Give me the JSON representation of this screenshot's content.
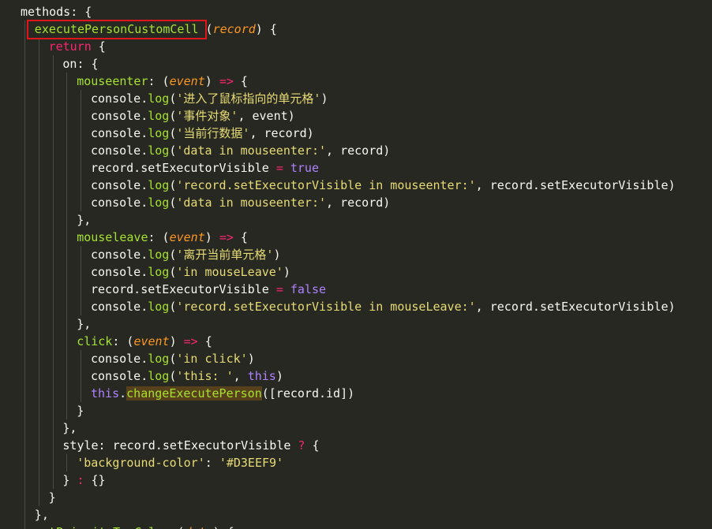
{
  "editor": {
    "lines": [
      {
        "indent": 0,
        "tokens": [
          [
            "t",
            "methods: {"
          ]
        ]
      },
      {
        "indent": 1,
        "tokens": [
          [
            "f",
            "executePersonCustomCell"
          ],
          [
            "t",
            " ("
          ],
          [
            "p",
            "record"
          ],
          [
            "t",
            ") {"
          ]
        ]
      },
      {
        "indent": 2,
        "tokens": [
          [
            "k",
            "return"
          ],
          [
            "t",
            " {"
          ]
        ]
      },
      {
        "indent": 3,
        "tokens": [
          [
            "t",
            "on: {"
          ]
        ]
      },
      {
        "indent": 4,
        "tokens": [
          [
            "f",
            "mouseenter"
          ],
          [
            "t",
            ": ("
          ],
          [
            "p",
            "event"
          ],
          [
            "t",
            ") "
          ],
          [
            "k",
            "=>"
          ],
          [
            "t",
            " {"
          ]
        ]
      },
      {
        "indent": 5,
        "tokens": [
          [
            "t",
            "console."
          ],
          [
            "f",
            "log"
          ],
          [
            "t",
            "("
          ],
          [
            "s",
            "'进入了鼠标指向的单元格'"
          ],
          [
            "t",
            ")"
          ]
        ]
      },
      {
        "indent": 5,
        "tokens": [
          [
            "t",
            "console."
          ],
          [
            "f",
            "log"
          ],
          [
            "t",
            "("
          ],
          [
            "s",
            "'事件对象'"
          ],
          [
            "t",
            ", event)"
          ]
        ]
      },
      {
        "indent": 5,
        "tokens": [
          [
            "t",
            "console."
          ],
          [
            "f",
            "log"
          ],
          [
            "t",
            "("
          ],
          [
            "s",
            "'当前行数据'"
          ],
          [
            "t",
            ", record)"
          ]
        ]
      },
      {
        "indent": 5,
        "tokens": [
          [
            "t",
            "console."
          ],
          [
            "f",
            "log"
          ],
          [
            "t",
            "("
          ],
          [
            "s",
            "'data in mouseenter:'"
          ],
          [
            "t",
            ", record)"
          ]
        ]
      },
      {
        "indent": 5,
        "tokens": [
          [
            "t",
            "record.setExecutorVisible "
          ],
          [
            "k",
            "="
          ],
          [
            "t",
            " "
          ],
          [
            "c",
            "true"
          ]
        ]
      },
      {
        "indent": 5,
        "tokens": [
          [
            "t",
            "console."
          ],
          [
            "f",
            "log"
          ],
          [
            "t",
            "("
          ],
          [
            "s",
            "'record.setExecutorVisible in mouseenter:'"
          ],
          [
            "t",
            ", record.setExecutorVisible)"
          ]
        ]
      },
      {
        "indent": 5,
        "tokens": [
          [
            "t",
            "console."
          ],
          [
            "f",
            "log"
          ],
          [
            "t",
            "("
          ],
          [
            "s",
            "'data in mouseenter:'"
          ],
          [
            "t",
            ", record)"
          ]
        ]
      },
      {
        "indent": 4,
        "tokens": [
          [
            "t",
            "},"
          ]
        ]
      },
      {
        "indent": 4,
        "tokens": [
          [
            "f",
            "mouseleave"
          ],
          [
            "t",
            ": ("
          ],
          [
            "p",
            "event"
          ],
          [
            "t",
            ") "
          ],
          [
            "k",
            "=>"
          ],
          [
            "t",
            " {"
          ]
        ]
      },
      {
        "indent": 5,
        "tokens": [
          [
            "t",
            "console."
          ],
          [
            "f",
            "log"
          ],
          [
            "t",
            "("
          ],
          [
            "s",
            "'离开当前单元格'"
          ],
          [
            "t",
            ")"
          ]
        ]
      },
      {
        "indent": 5,
        "tokens": [
          [
            "t",
            "console."
          ],
          [
            "f",
            "log"
          ],
          [
            "t",
            "("
          ],
          [
            "s",
            "'in mouseLeave'"
          ],
          [
            "t",
            ")"
          ]
        ]
      },
      {
        "indent": 5,
        "tokens": [
          [
            "t",
            "record.setExecutorVisible "
          ],
          [
            "k",
            "="
          ],
          [
            "t",
            " "
          ],
          [
            "c",
            "false"
          ]
        ]
      },
      {
        "indent": 5,
        "tokens": [
          [
            "t",
            "console."
          ],
          [
            "f",
            "log"
          ],
          [
            "t",
            "("
          ],
          [
            "s",
            "'record.setExecutorVisible in mouseLeave:'"
          ],
          [
            "t",
            ", record.setExecutorVisible)"
          ]
        ]
      },
      {
        "indent": 4,
        "tokens": [
          [
            "t",
            "},"
          ]
        ]
      },
      {
        "indent": 4,
        "tokens": [
          [
            "f",
            "click"
          ],
          [
            "t",
            ": ("
          ],
          [
            "p",
            "event"
          ],
          [
            "t",
            ") "
          ],
          [
            "k",
            "=>"
          ],
          [
            "t",
            " {"
          ]
        ]
      },
      {
        "indent": 5,
        "tokens": [
          [
            "t",
            "console."
          ],
          [
            "f",
            "log"
          ],
          [
            "t",
            "("
          ],
          [
            "s",
            "'in click'"
          ],
          [
            "t",
            ")"
          ]
        ]
      },
      {
        "indent": 5,
        "tokens": [
          [
            "t",
            "console."
          ],
          [
            "f",
            "log"
          ],
          [
            "t",
            "("
          ],
          [
            "s",
            "'this: '"
          ],
          [
            "t",
            ", "
          ],
          [
            "c",
            "this"
          ],
          [
            "t",
            ")"
          ]
        ]
      },
      {
        "indent": 5,
        "tokens": [
          [
            "c",
            "this"
          ],
          [
            "t",
            "."
          ],
          [
            "f",
            "changeExecutePerson"
          ],
          [
            "t",
            "([record.id])"
          ]
        ]
      },
      {
        "indent": 4,
        "tokens": [
          [
            "t",
            "}"
          ]
        ]
      },
      {
        "indent": 3,
        "tokens": [
          [
            "t",
            "},"
          ]
        ]
      },
      {
        "indent": 3,
        "tokens": [
          [
            "t",
            "style: record.setExecutorVisible "
          ],
          [
            "k",
            "?"
          ],
          [
            "t",
            " {"
          ]
        ]
      },
      {
        "indent": 4,
        "tokens": [
          [
            "s",
            "'background-color'"
          ],
          [
            "t",
            ": "
          ],
          [
            "s",
            "'#D3EEF9'"
          ]
        ]
      },
      {
        "indent": 3,
        "tokens": [
          [
            "t",
            "} "
          ],
          [
            "k",
            ":"
          ],
          [
            "t",
            " {}"
          ]
        ]
      },
      {
        "indent": 2,
        "tokens": [
          [
            "t",
            "}"
          ]
        ]
      },
      {
        "indent": 1,
        "tokens": [
          [
            "t",
            "},"
          ]
        ]
      },
      {
        "indent": 1,
        "tokens": [
          [
            "f",
            "getPriorityTagColor"
          ],
          [
            "t",
            " ("
          ],
          [
            "p",
            "data"
          ],
          [
            "t",
            ") {"
          ]
        ]
      }
    ]
  },
  "highlight": {
    "boxed_function": "executePersonCustomCell",
    "selected_word": "changeExecutePerson"
  },
  "colors": {
    "background": "#272822",
    "plain": "#f8f8f2",
    "keyword": "#f92672",
    "function": "#a6e22e",
    "string": "#e6db74",
    "parameter": "#fd971f",
    "constant": "#ae81ff",
    "box": "#e0141b"
  }
}
